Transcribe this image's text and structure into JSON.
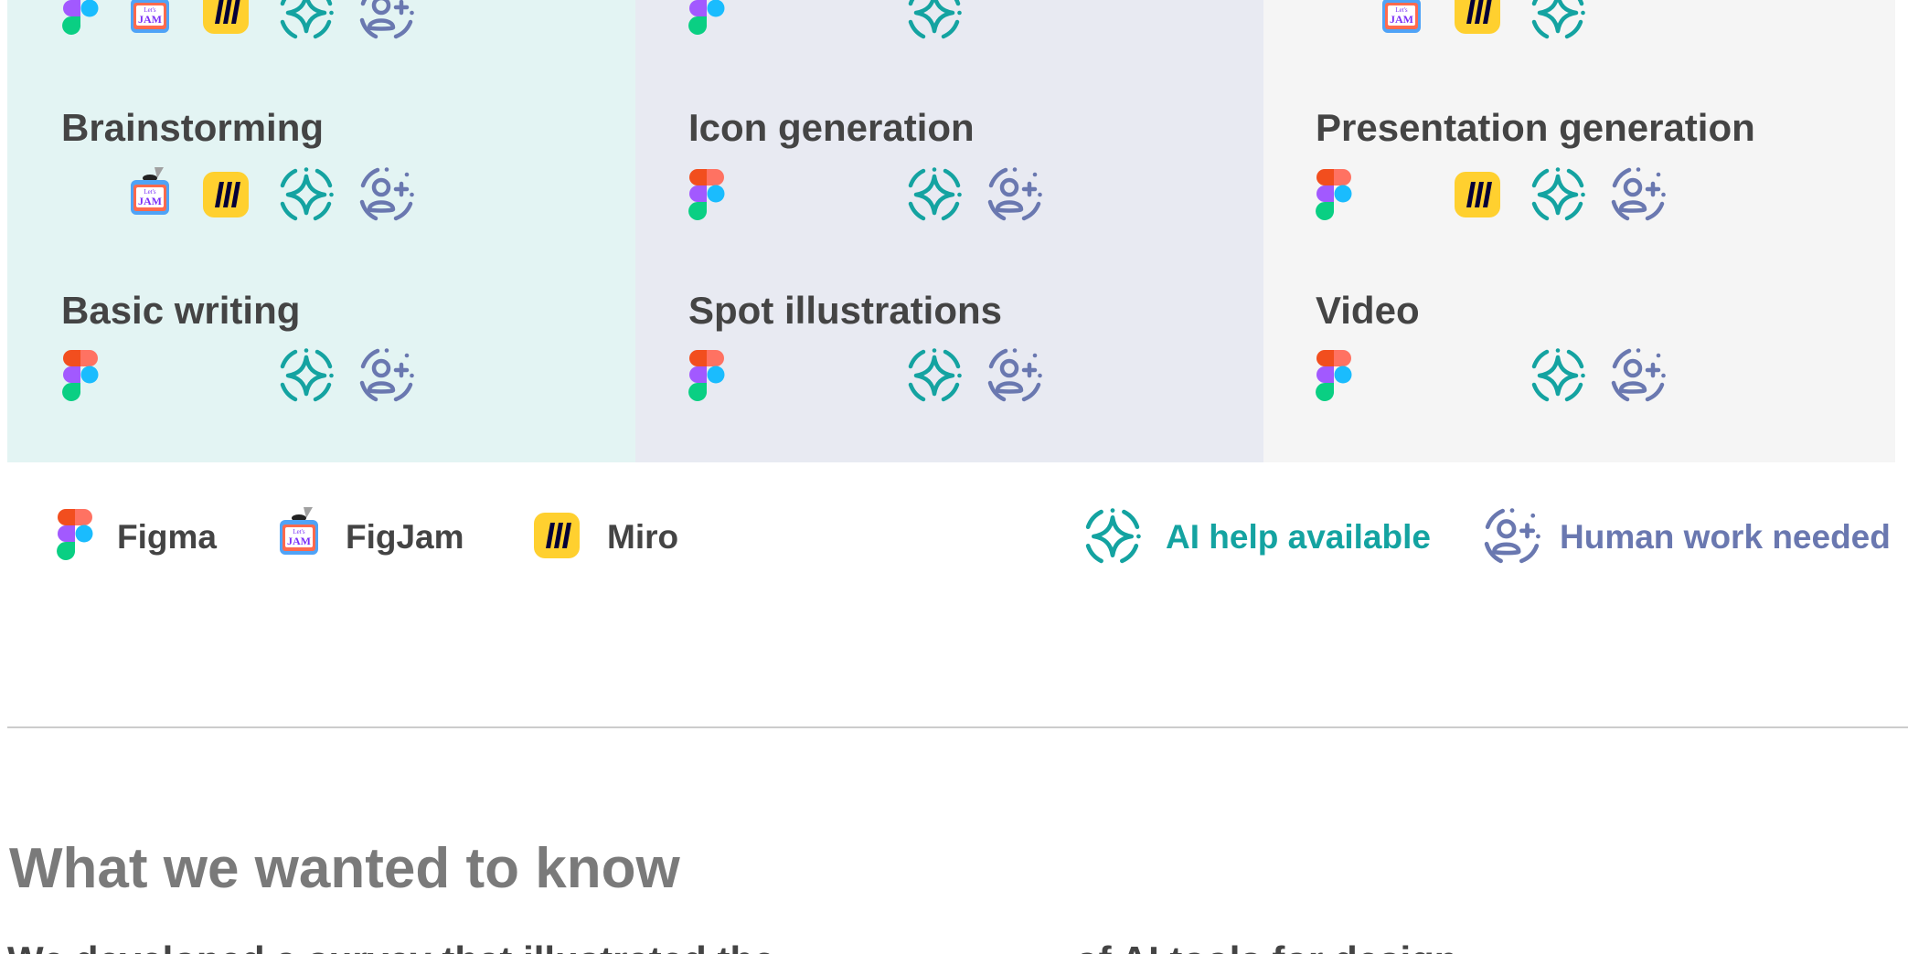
{
  "colors": {
    "teal_bg": "#e3f4f3",
    "lavender_bg": "#e8eaf2",
    "gray_bg": "#f5f5f5",
    "ai_accent": "#14a3a1",
    "human_accent": "#6a78b0"
  },
  "columns": [
    {
      "rows": [
        {
          "title": "",
          "tools": [
            "figma-icon",
            "figjam-icon",
            "miro-icon"
          ],
          "ai": true,
          "human": true
        },
        {
          "title": "Brainstorming",
          "tools": [
            "figjam-icon",
            "miro-icon"
          ],
          "ai": true,
          "human": true
        },
        {
          "title": "Basic writing",
          "tools": [
            "figma-icon"
          ],
          "ai": true,
          "human": true
        }
      ]
    },
    {
      "rows": [
        {
          "title": "",
          "tools": [
            "figma-icon"
          ],
          "ai": true,
          "human": false
        },
        {
          "title": "Icon generation",
          "tools": [
            "figma-icon"
          ],
          "ai": true,
          "human": true
        },
        {
          "title": "Spot illustrations",
          "tools": [
            "figma-icon"
          ],
          "ai": true,
          "human": true
        }
      ]
    },
    {
      "rows": [
        {
          "title": "",
          "tools": [
            "figjam-icon",
            "miro-icon"
          ],
          "ai": true,
          "human": false
        },
        {
          "title": "Presentation generation",
          "tools": [
            "figma-icon",
            "miro-icon"
          ],
          "ai": true,
          "human": true
        },
        {
          "title": "Video",
          "tools": [
            "figma-icon"
          ],
          "ai": true,
          "human": true
        }
      ]
    }
  ],
  "legend": {
    "figma": "Figma",
    "figjam": "FigJam",
    "miro": "Miro",
    "ai": "AI help available",
    "human": "Human work needed"
  },
  "section": {
    "heading": "What we wanted to know",
    "cut_text_left": "We developed a survey that illustrated the",
    "cut_text_right": "of AI tools for design"
  }
}
